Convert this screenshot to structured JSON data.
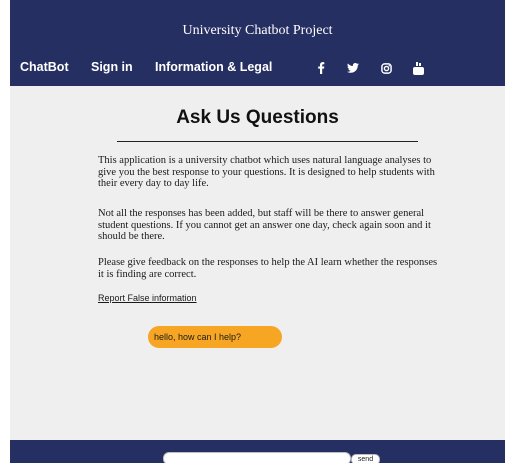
{
  "header": {
    "site_title": "University Chatbot Project",
    "nav": {
      "chatbot": "ChatBot",
      "sign_in": "Sign in",
      "info_legal": "Information & Legal"
    },
    "social_icons": [
      "facebook-icon",
      "twitter-icon",
      "instagram-icon",
      "youtube-icon"
    ]
  },
  "main": {
    "title": "Ask Us Questions",
    "paragraphs": [
      "This application is a university chatbot which uses natural language analyses to give you the best response to your questions. It is designed to help students with their every day to day life.",
      "Not all the responses has been added, but staff will be there to answer general student questions. If you cannot get an answer one day, check again soon and it should be there.",
      "Please give feedback on the responses to help the AI learn whether the responses it is finding are correct."
    ],
    "report_link": "Report False information"
  },
  "chat": {
    "messages": [
      {
        "text": "hello, how can I help?"
      }
    ],
    "input_value": "",
    "send_label": "send"
  },
  "colors": {
    "navy": "#262f62",
    "background": "#efefef",
    "bubble": "#f6a623"
  }
}
